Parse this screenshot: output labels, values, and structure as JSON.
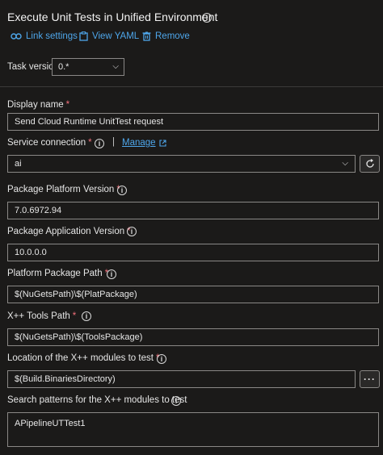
{
  "header": {
    "title": "Execute Unit Tests in Unified Environment",
    "link_settings": "Link settings",
    "view_yaml": "View YAML",
    "remove": "Remove"
  },
  "task_version": {
    "label": "Task version",
    "value": "0.*"
  },
  "fields": {
    "display_name": {
      "label": "Display name",
      "value": "Send Cloud Runtime UnitTest request"
    },
    "service_connection": {
      "label": "Service connection",
      "manage": "Manage",
      "value": "ai",
      "separator": "|"
    },
    "package_platform_version": {
      "label": "Package Platform Version",
      "value": "7.0.6972.94"
    },
    "package_application_version": {
      "label": "Package Application Version",
      "value": "10.0.0.0"
    },
    "platform_package_path": {
      "label": "Platform Package Path",
      "value": "$(NuGetsPath)\\$(PlatPackage)"
    },
    "tools_path": {
      "label": "X++ Tools Path",
      "value": "$(NuGetsPath)\\$(ToolsPackage)"
    },
    "modules_location": {
      "label": "Location of the X++ modules to test",
      "value": "$(Build.BinariesDirectory)",
      "browse": "···"
    },
    "search_patterns": {
      "label": "Search patterns for the X++ modules to test",
      "value": "APipelineUTTest1"
    }
  },
  "required_mark": "*",
  "colors": {
    "background": "#1b1a19",
    "accent": "#4ea6ea",
    "required": "#f1707b",
    "border": "#8a8886"
  }
}
